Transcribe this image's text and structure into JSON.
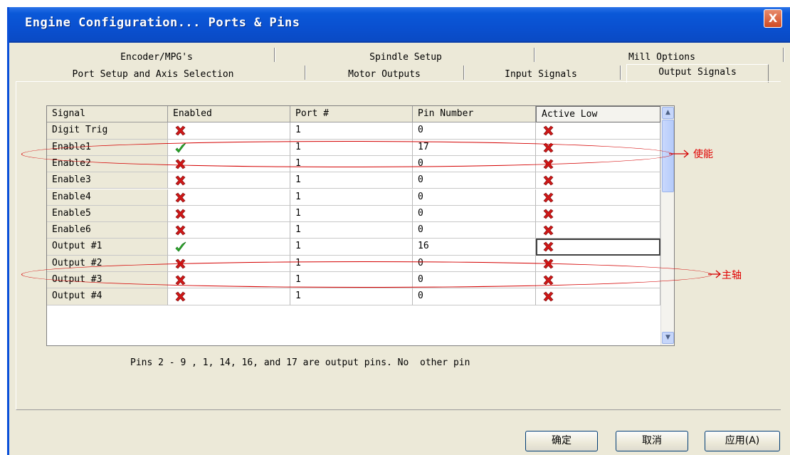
{
  "window": {
    "title": "Engine Configuration... Ports & Pins",
    "close_label": "X"
  },
  "tabs": {
    "row1": [
      "Encoder/MPG's",
      "Spindle Setup",
      "Mill Options"
    ],
    "row2": [
      "Port Setup and Axis Selection",
      "Motor Outputs",
      "Input Signals",
      "Output Signals"
    ],
    "active": "Output Signals"
  },
  "table": {
    "headers": [
      "Signal",
      "Enabled",
      "Port #",
      "Pin Number",
      "Active Low"
    ],
    "rows": [
      {
        "signal": "Digit  Trig",
        "enabled": false,
        "port": "1",
        "pin": "0",
        "active_low": false
      },
      {
        "signal": "Enable1",
        "enabled": true,
        "port": "1",
        "pin": "17",
        "active_low": false
      },
      {
        "signal": "Enable2",
        "enabled": false,
        "port": "1",
        "pin": "0",
        "active_low": false
      },
      {
        "signal": "Enable3",
        "enabled": false,
        "port": "1",
        "pin": "0",
        "active_low": false
      },
      {
        "signal": "Enable4",
        "enabled": false,
        "port": "1",
        "pin": "0",
        "active_low": false
      },
      {
        "signal": "Enable5",
        "enabled": false,
        "port": "1",
        "pin": "0",
        "active_low": false
      },
      {
        "signal": "Enable6",
        "enabled": false,
        "port": "1",
        "pin": "0",
        "active_low": false
      },
      {
        "signal": "Output #1",
        "enabled": true,
        "port": "1",
        "pin": "16",
        "active_low": false
      },
      {
        "signal": "Output #2",
        "enabled": false,
        "port": "1",
        "pin": "0",
        "active_low": false
      },
      {
        "signal": "Output #3",
        "enabled": false,
        "port": "1",
        "pin": "0",
        "active_low": false
      },
      {
        "signal": "Output #4",
        "enabled": false,
        "port": "1",
        "pin": "0",
        "active_low": false
      }
    ]
  },
  "note": "Pins 2 - 9 , 1, 14, 16, and 17 are output pins. No  other pin",
  "annotations": {
    "enable": "使能",
    "spindle": "主轴"
  },
  "buttons": {
    "ok": "确定",
    "cancel": "取消",
    "apply": "应用(A)"
  },
  "icons": {
    "enabled_true": "green-check-icon",
    "enabled_false": "red-x-icon"
  },
  "colors": {
    "title_bar": "#0a58d8",
    "annotation": "#d40000",
    "check": "#2fb52f",
    "cross": "#d01818"
  }
}
